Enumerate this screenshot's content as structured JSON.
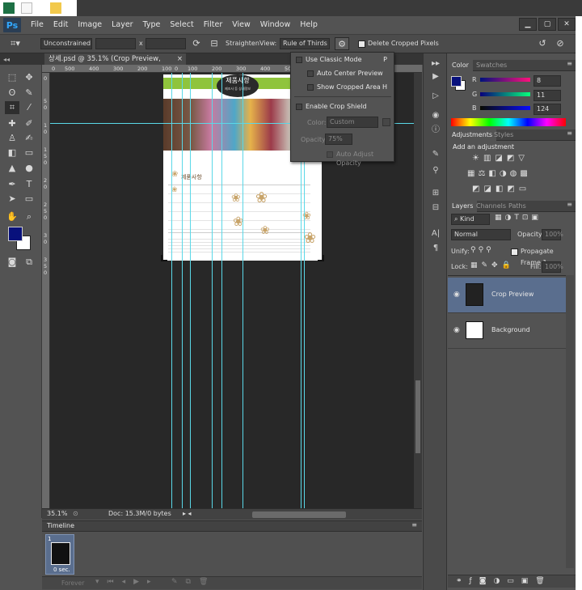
{
  "app": {
    "logo": "Ps"
  },
  "menu": [
    "File",
    "Edit",
    "Image",
    "Layer",
    "Type",
    "Select",
    "Filter",
    "View",
    "Window",
    "Help"
  ],
  "window_buttons": [
    "▁",
    "▢",
    "✕"
  ],
  "options_bar": {
    "ratio_value": "Unconstrained",
    "x_label": "x",
    "straighten_label": "Straighten",
    "view_label": "View:",
    "overlay_value": "Rule of Thirds",
    "delete_cropped_label": "Delete Cropped Pixels"
  },
  "document_tab": {
    "title": "상세.psd @ 35.1% (Crop Preview, RGB/8) *",
    "close": "×"
  },
  "ruler": {
    "h_ticks": [
      "0",
      "500",
      "400",
      "300",
      "200",
      "100",
      "0",
      "100",
      "200",
      "300",
      "400",
      "500",
      "600",
      "700",
      "800",
      "900"
    ],
    "v_ticks": [
      "0",
      "5",
      "0",
      "1",
      "0",
      "1",
      "5",
      "0",
      "2",
      "0",
      "2",
      "5",
      "0",
      "3",
      "0",
      "3",
      "5",
      "0"
    ]
  },
  "flyout": {
    "use_classic": "Use Classic Mode",
    "use_classic_key": "P",
    "auto_center": "Auto Center Preview",
    "show_cropped": "Show Cropped Area",
    "show_cropped_key": "H",
    "enable_shield": "Enable Crop Shield",
    "color_label": "Color:",
    "color_value": "Custom",
    "opacity_label": "Opacity:",
    "opacity_value": "75%",
    "auto_adjust": "Auto Adjust Opacity"
  },
  "doc_content": {
    "banner_title": "제품사항",
    "banner_sub": "제조사 등 상세정보",
    "section_title": "제품사항"
  },
  "status": {
    "zoom": "35.1%",
    "doc": "Doc: 15.3M/0 bytes"
  },
  "timeline": {
    "title": "Timeline",
    "frame_number": "1",
    "frame_delay": "0 sec.",
    "loop": "Forever"
  },
  "color_panel": {
    "tabs": [
      "Color",
      "Swatches"
    ],
    "r_label": "R",
    "r_value": "8",
    "g_label": "G",
    "g_value": "11",
    "b_label": "B",
    "b_value": "124"
  },
  "adjustments_panel": {
    "tabs": [
      "Adjustments",
      "Styles"
    ],
    "heading": "Add an adjustment"
  },
  "layers_panel": {
    "tabs": [
      "Layers",
      "Channels",
      "Paths"
    ],
    "kind_value": "Kind",
    "blend_value": "Normal",
    "opacity_label": "Opacity:",
    "opacity_value": "100%",
    "unify_label": "Unify:",
    "propagate_label": "Propagate Frame 1",
    "lock_label": "Lock:",
    "fill_label": "Fill:",
    "fill_value": "100%",
    "layers": [
      {
        "name": "Crop Preview"
      },
      {
        "name": "Background"
      }
    ]
  },
  "colors": {
    "foreground": "#08117c",
    "background": "#ffffff",
    "selected_layer": "#5a6e8e",
    "guide": "#5ad8e8",
    "banner_green": "#8fc43c"
  }
}
